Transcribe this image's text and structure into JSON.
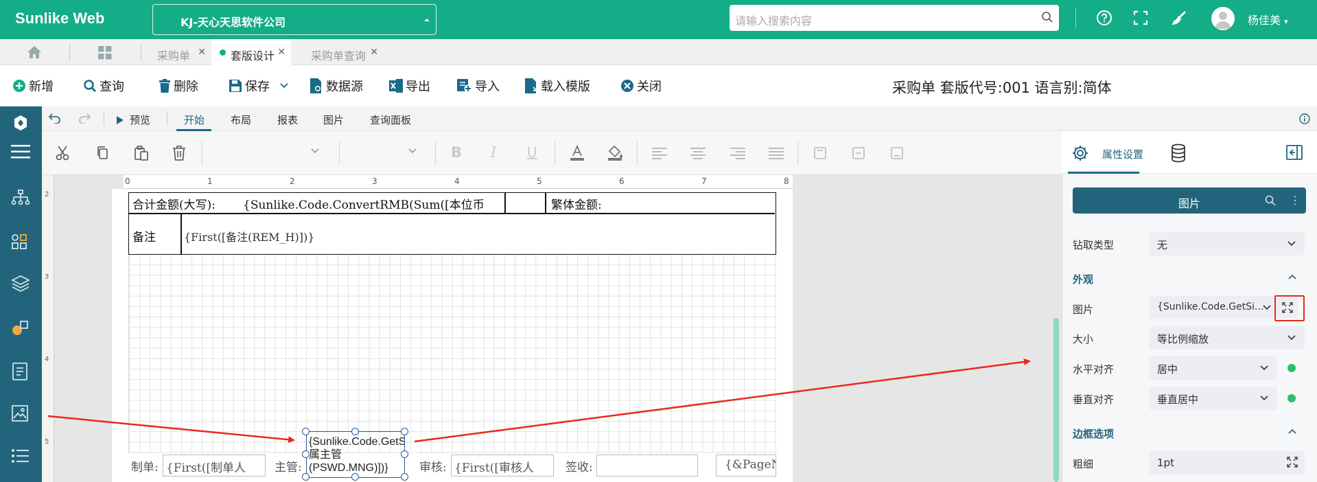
{
  "header": {
    "brand": "Sunlike Web",
    "company": "KJ-天心天思软件公司",
    "search_placeholder": "请输入搜索内容",
    "user_name": "杨佳美",
    "colors": {
      "brand": "#13ad87",
      "rail": "#22647c",
      "accent": "#1a6a8a",
      "annotation": "#e8281e"
    }
  },
  "tabs": [
    {
      "label": "采购单",
      "active": false
    },
    {
      "label": "套版设计",
      "active": true
    },
    {
      "label": "采购单查询",
      "active": false
    }
  ],
  "toolbar": {
    "new": "新增",
    "query": "查询",
    "delete": "删除",
    "save": "保存",
    "datasource": "数据源",
    "export": "导出",
    "import": "导入",
    "load_template": "载入模版",
    "close": "关闭",
    "doc_title": "采购单 套版代号:001 语言别:简体"
  },
  "ribbon": {
    "preview": "预览",
    "tabs": [
      "开始",
      "布局",
      "报表",
      "图片",
      "查询面板"
    ],
    "active_tab": "开始"
  },
  "ruler": {
    "h_marks": [
      "0",
      "1",
      "2",
      "3",
      "4",
      "5",
      "6",
      "7",
      "8"
    ],
    "v_marks": [
      "2",
      "3",
      "4",
      "5"
    ]
  },
  "report": {
    "total_label": "合计金额(大写):",
    "total_expr": "{Sunlike.Code.ConvertRMB(Sum([本位币",
    "trad_amount_label": "繁体金额:",
    "remark_label": "备注",
    "remark_expr": "{First([备注(REM_H)])}",
    "footer": {
      "maker_label": "制单:",
      "maker_expr": "{First([制单人",
      "supervisor_label": "主管:",
      "selected_image_expr": "{Sunlike.Code.GetSign([所属主管(PSWD.MNG)])}",
      "auditor_label": "审核:",
      "auditor_expr": "{First([审核人",
      "receiver_label": "签收:",
      "page_expr": "{&PageNu"
    }
  },
  "panel": {
    "tab_label": "属性设置",
    "object_type": "图片",
    "drill_label": "钻取类型",
    "drill_value": "无",
    "appearance_header": "外观",
    "image_label": "图片",
    "image_value": "{Sunlike.Code.GetSi...",
    "size_label": "大小",
    "size_value": "等比例缩放",
    "halign_label": "水平对齐",
    "halign_value": "居中",
    "valign_label": "垂直对齐",
    "valign_value": "垂直居中",
    "border_header": "边框选项",
    "thickness_label": "粗细",
    "thickness_value": "1pt"
  }
}
